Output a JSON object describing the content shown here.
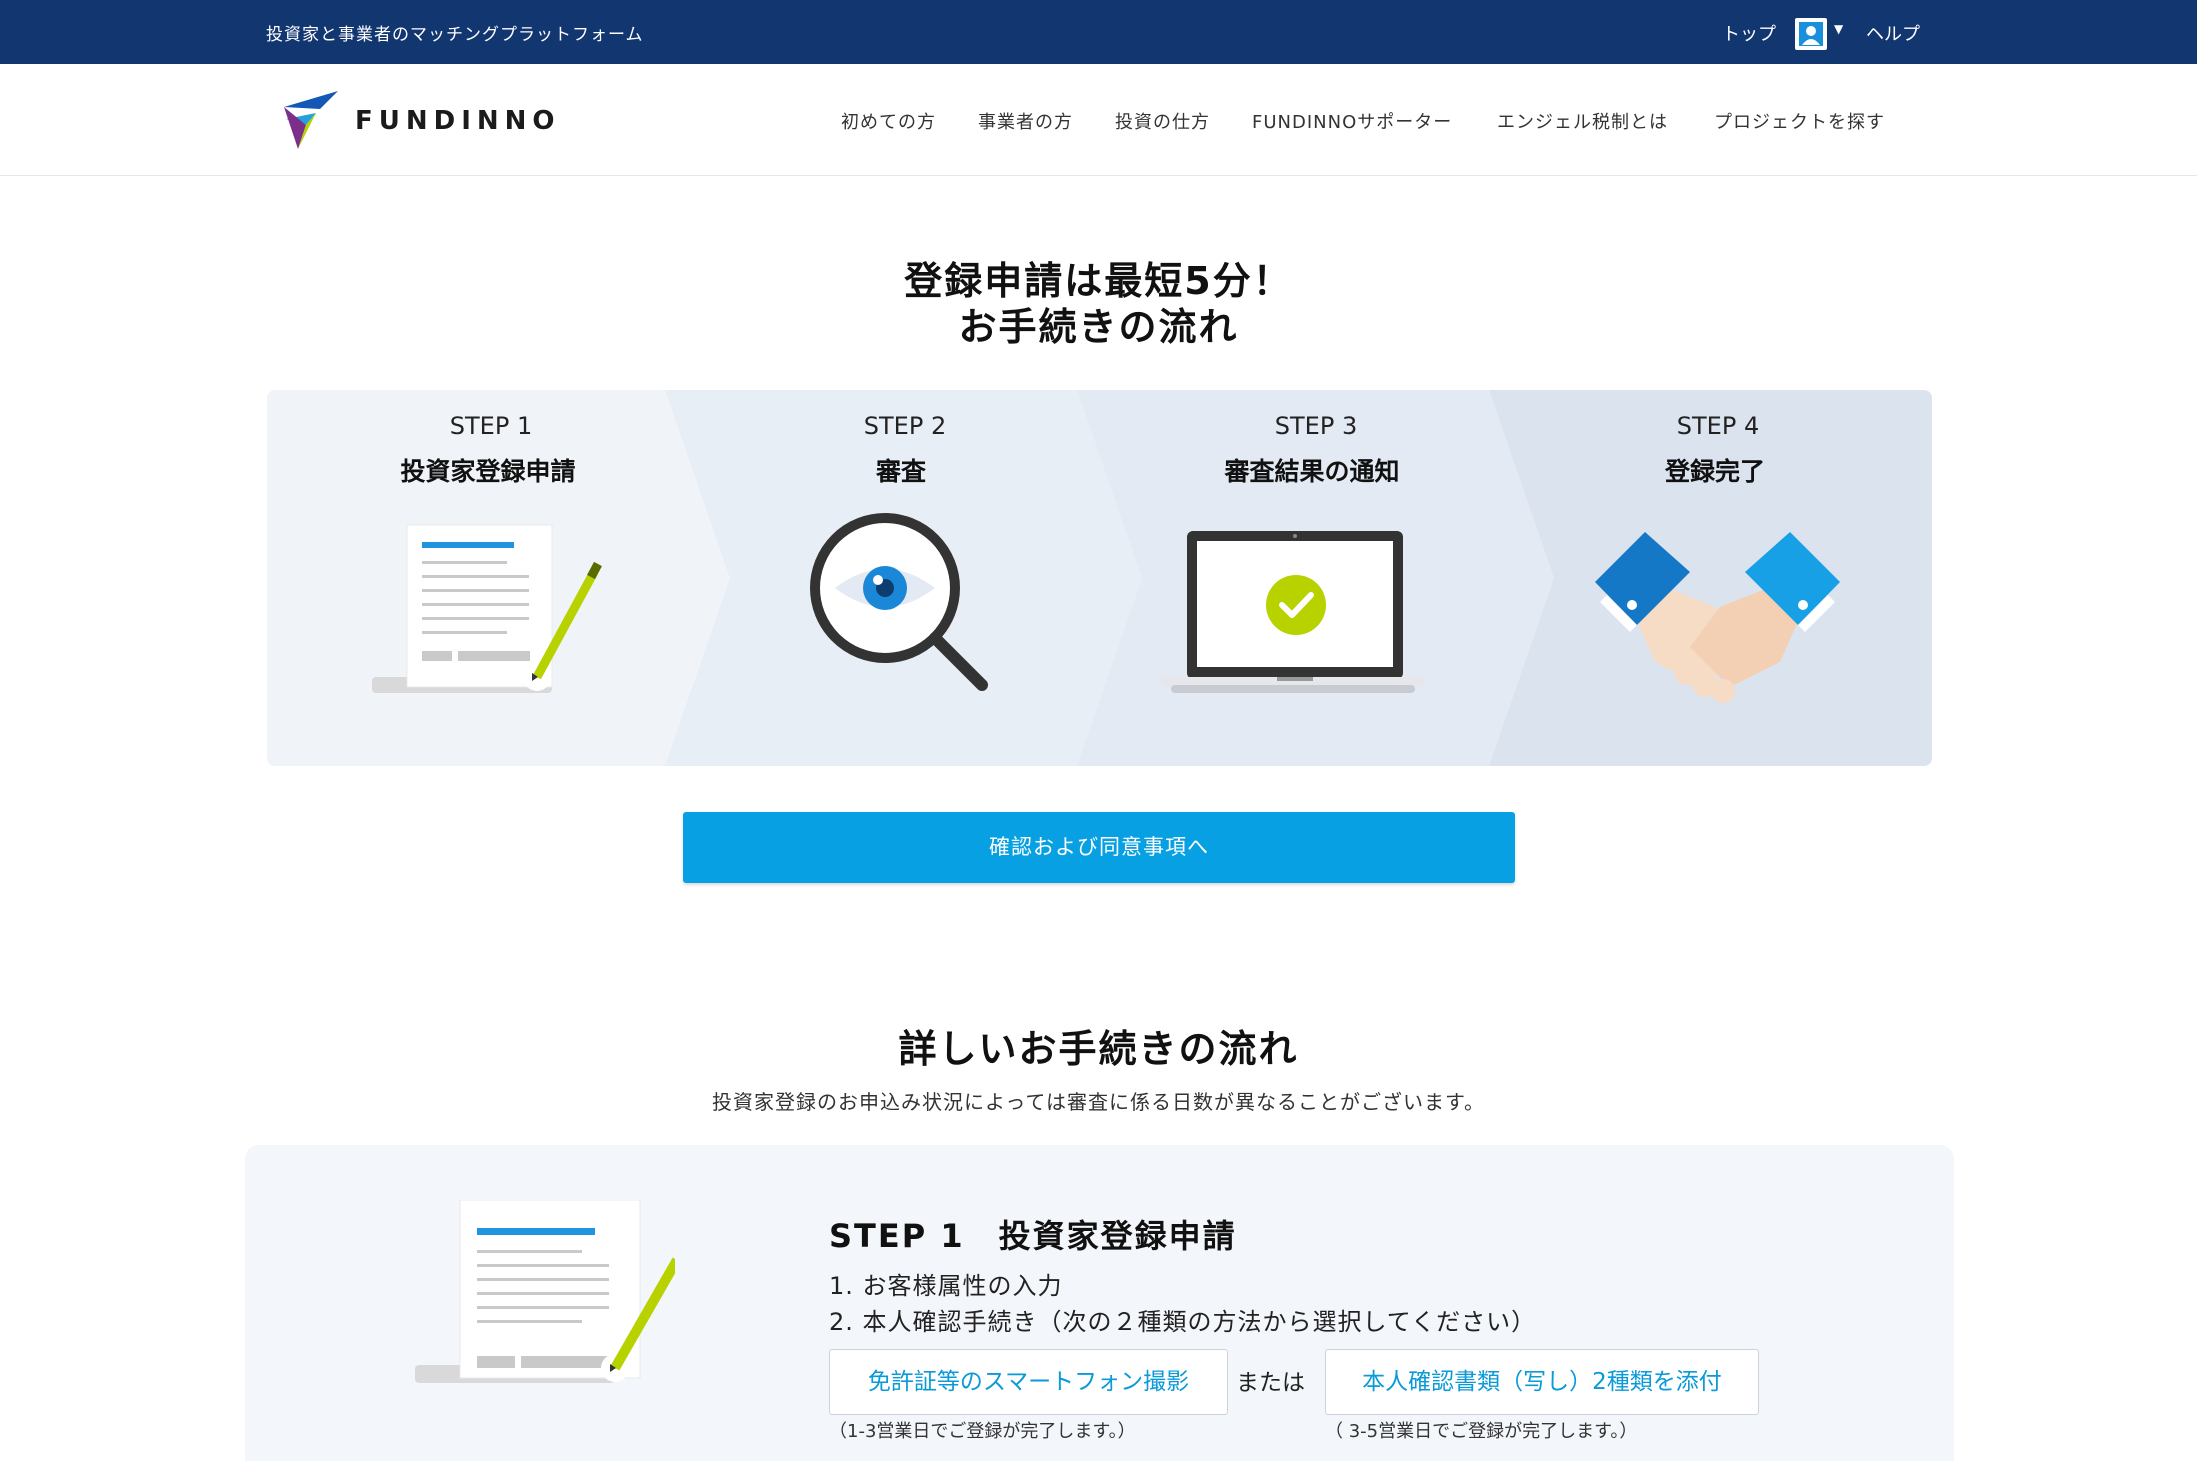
{
  "topbar": {
    "tagline": "投資家と事業者のマッチングプラットフォーム",
    "top_link": "トップ",
    "help_link": "ヘルプ"
  },
  "header": {
    "logo_text": "FUNDINNO",
    "nav": [
      "初めての方",
      "事業者の方",
      "投資の仕方",
      "FUNDINNOサポーター",
      "エンジェル税制とは",
      "プロジェクトを探す"
    ]
  },
  "hero": {
    "title_line1": "登録申請は最短5分！",
    "title_line2": "お手続きの流れ"
  },
  "steps": [
    {
      "label": "STEP 1",
      "title": "投資家登録申請",
      "icon": "document-pencil-icon"
    },
    {
      "label": "STEP 2",
      "title": "審査",
      "icon": "magnifier-eye-icon"
    },
    {
      "label": "STEP 3",
      "title": "審査結果の通知",
      "icon": "laptop-check-icon"
    },
    {
      "label": "STEP 4",
      "title": "登録完了",
      "icon": "handshake-icon"
    }
  ],
  "cta": {
    "label": "確認および同意事項へ"
  },
  "details": {
    "title": "詳しいお手続きの流れ",
    "note": "投資家登録のお申込み状況によっては審査に係る日数が異なることがございます。",
    "step_title": "STEP 1　投資家登録申請",
    "item1": "1. お客様属性の入力",
    "item2": "2. 本人確認手続き（次の２種類の方法から選択してください）",
    "option1": "免許証等のスマートフォン撮影",
    "or": "または",
    "option2": "本人確認書類（写し）2種類を添付",
    "option1_note": "（1-3営業日でご登録が完了します。）",
    "option2_note": "（ 3-5営業日でご登録が完了します。）"
  },
  "colors": {
    "topbar": "#113670",
    "accent": "#07a0e3",
    "lime": "#b8d200",
    "panel": "#f0f4f9"
  }
}
